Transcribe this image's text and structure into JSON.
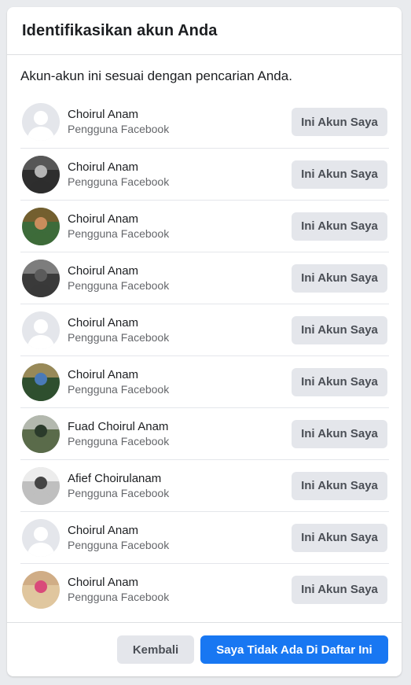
{
  "dialog": {
    "title": "Identifikasikan akun Anda",
    "intro": "Akun-akun ini sesuai dengan pencarian Anda."
  },
  "accounts": [
    {
      "name": "Choirul Anam",
      "subtitle": "Pengguna Facebook",
      "button": "Ini Akun Saya",
      "avatar": "default-avatar-icon"
    },
    {
      "name": "Choirul Anam",
      "subtitle": "Pengguna Facebook",
      "button": "Ini Akun Saya",
      "avatar": "profile-photo"
    },
    {
      "name": "Choirul Anam",
      "subtitle": "Pengguna Facebook",
      "button": "Ini Akun Saya",
      "avatar": "profile-photo"
    },
    {
      "name": "Choirul Anam",
      "subtitle": "Pengguna Facebook",
      "button": "Ini Akun Saya",
      "avatar": "profile-photo"
    },
    {
      "name": "Choirul Anam",
      "subtitle": "Pengguna Facebook",
      "button": "Ini Akun Saya",
      "avatar": "default-avatar-icon"
    },
    {
      "name": "Choirul Anam",
      "subtitle": "Pengguna Facebook",
      "button": "Ini Akun Saya",
      "avatar": "profile-photo"
    },
    {
      "name": "Fuad Choirul Anam",
      "subtitle": "Pengguna Facebook",
      "button": "Ini Akun Saya",
      "avatar": "profile-photo"
    },
    {
      "name": "Afief Choirulanam",
      "subtitle": "Pengguna Facebook",
      "button": "Ini Akun Saya",
      "avatar": "profile-photo"
    },
    {
      "name": "Choirul Anam",
      "subtitle": "Pengguna Facebook",
      "button": "Ini Akun Saya",
      "avatar": "default-avatar-icon"
    },
    {
      "name": "Choirul Anam",
      "subtitle": "Pengguna Facebook",
      "button": "Ini Akun Saya",
      "avatar": "profile-photo"
    }
  ],
  "footer": {
    "back_label": "Kembali",
    "not_listed_label": "Saya Tidak Ada Di Daftar Ini"
  },
  "colors": {
    "primary": "#1877f2",
    "secondary_button": "#e4e6eb",
    "page_background": "#e9ebee"
  }
}
